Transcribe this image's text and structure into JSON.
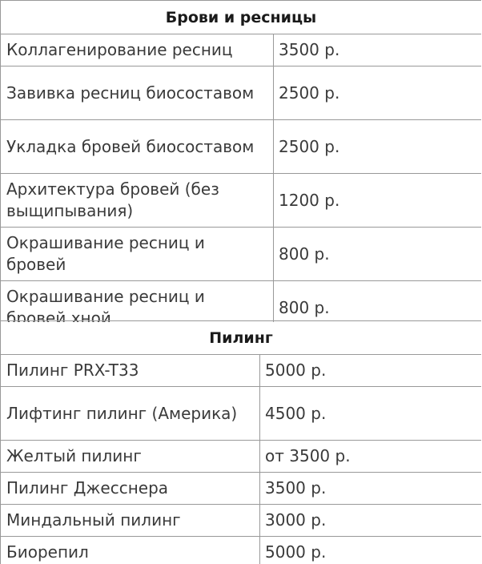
{
  "sections": [
    {
      "title": "Брови и ресницы",
      "rows": [
        {
          "service": "Коллагенирование ресниц",
          "price": "3500 р."
        },
        {
          "service": "Завивка ресниц биосоставом",
          "price": "2500 р."
        },
        {
          "service": "Укладка бровей биосоставом",
          "price": "2500 р."
        },
        {
          "service": "Архитектура бровей (без выщипывания)",
          "price": "1200 р."
        },
        {
          "service": "Окрашивание ресниц и бровей",
          "price": "800 р."
        },
        {
          "service": "Окрашивание ресниц и бровей хной",
          "price": "800 р."
        }
      ]
    },
    {
      "title": "Пилинг",
      "rows": [
        {
          "service": "Пилинг PRX-T33",
          "price": "5000 р."
        },
        {
          "service": "Лифтинг пилинг (Америка)",
          "price": "4500 р."
        },
        {
          "service": "Желтый пилинг",
          "price": "от 3500 р."
        },
        {
          "service": "Пилинг Джесснера",
          "price": "3500 р."
        },
        {
          "service": "Миндальный пилинг",
          "price": "3000 р."
        },
        {
          "service": "Биорепил",
          "price": "5000 р."
        }
      ]
    }
  ]
}
